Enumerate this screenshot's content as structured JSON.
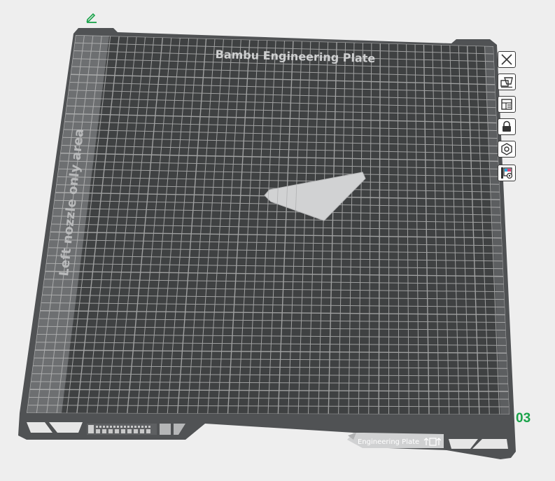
{
  "plate": {
    "title": "Bambu Engineering Plate",
    "left_zone_label": "Left nozzle only area",
    "bottom_badge_label": "Engineering Plate",
    "number": "03"
  },
  "toolbar": {
    "buttons": [
      {
        "name": "close-plate-button",
        "icon": "close-icon"
      },
      {
        "name": "arrange-button",
        "icon": "arrange-icon"
      },
      {
        "name": "orient-button",
        "icon": "orient-icon"
      },
      {
        "name": "lock-button",
        "icon": "lock-icon"
      },
      {
        "name": "plate-settings-button",
        "icon": "settings-hexagon-icon"
      },
      {
        "name": "plate-type-button",
        "icon": "plate-type-icon"
      }
    ]
  },
  "colors": {
    "plate": "#3f4142",
    "frame": "#505254",
    "grid": "#c0c0c0",
    "left_zone": "#6d6f71",
    "object": "#d1d2d3",
    "accent": "#1aa34a"
  }
}
